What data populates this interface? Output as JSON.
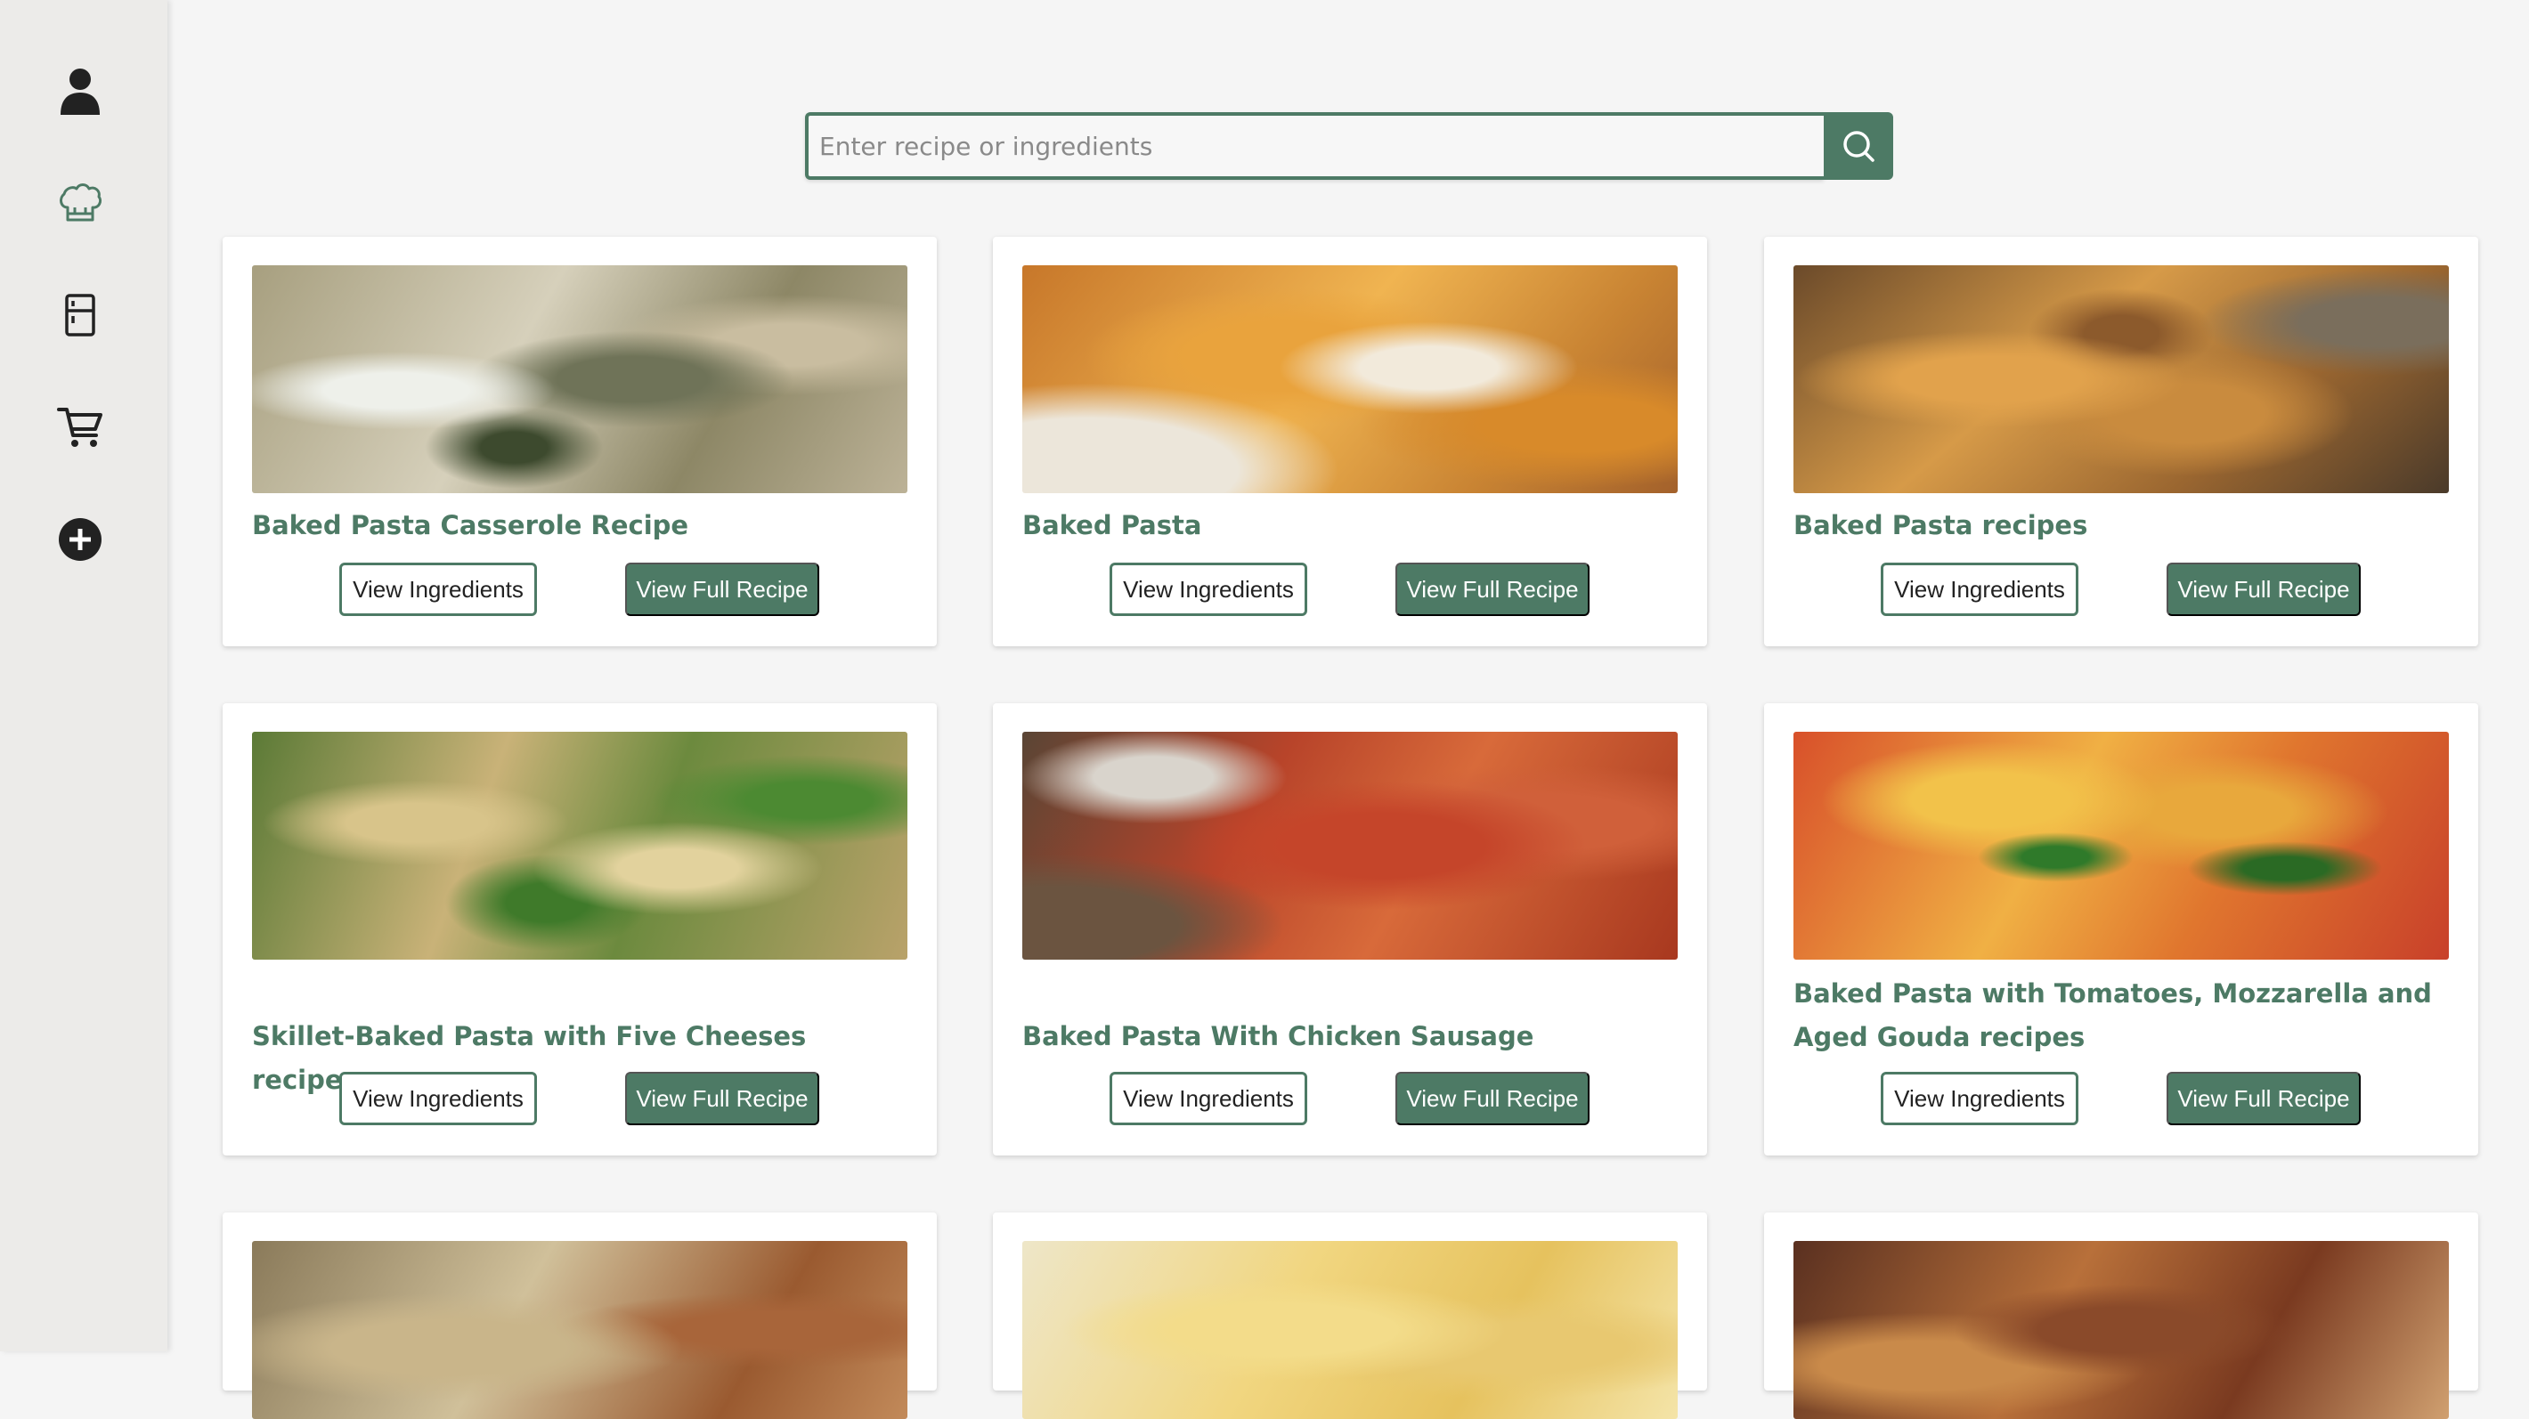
{
  "sidebar": {
    "items": [
      {
        "icon": "user-icon"
      },
      {
        "icon": "chef-hat-icon"
      },
      {
        "icon": "fridge-icon"
      },
      {
        "icon": "shopping-cart-icon"
      },
      {
        "icon": "add-circle-icon"
      }
    ]
  },
  "search": {
    "placeholder": "Enter recipe or ingredients",
    "value": "",
    "button_icon": "search-icon"
  },
  "colors": {
    "accent": "#4d7a65",
    "background": "#f5f5f5",
    "sidebar": "#ecebe9",
    "card": "#ffffff"
  },
  "buttons": {
    "view_ingredients": "View Ingredients",
    "view_full_recipe": "View Full Recipe"
  },
  "recipes": [
    {
      "title": "Baked Pasta Casserole Recipe",
      "ingredients_label": "View Ingredients",
      "recipe_label": "View Full Recipe",
      "image": "baked-pasta-casserole-photo"
    },
    {
      "title": "Baked Pasta",
      "ingredients_label": "View Ingredients",
      "recipe_label": "View Full Recipe",
      "image": "baked-pasta-photo"
    },
    {
      "title": "Baked Pasta recipes",
      "ingredients_label": "View Ingredients",
      "recipe_label": "View Full Recipe",
      "image": "baked-pasta-recipes-photo"
    },
    {
      "title": "Skillet-Baked Pasta with Five Cheeses recipes",
      "ingredients_label": "View Ingredients",
      "recipe_label": "View Full Recipe",
      "image": "skillet-baked-pasta-photo"
    },
    {
      "title": "Baked Pasta With Chicken Sausage",
      "ingredients_label": "View Ingredients",
      "recipe_label": "View Full Recipe",
      "image": "chicken-sausage-pasta-photo"
    },
    {
      "title": "Baked Pasta with Tomatoes, Mozzarella and Aged Gouda recipes",
      "ingredients_label": "View Ingredients",
      "recipe_label": "View Full Recipe",
      "image": "tomato-mozzarella-pasta-photo"
    }
  ]
}
